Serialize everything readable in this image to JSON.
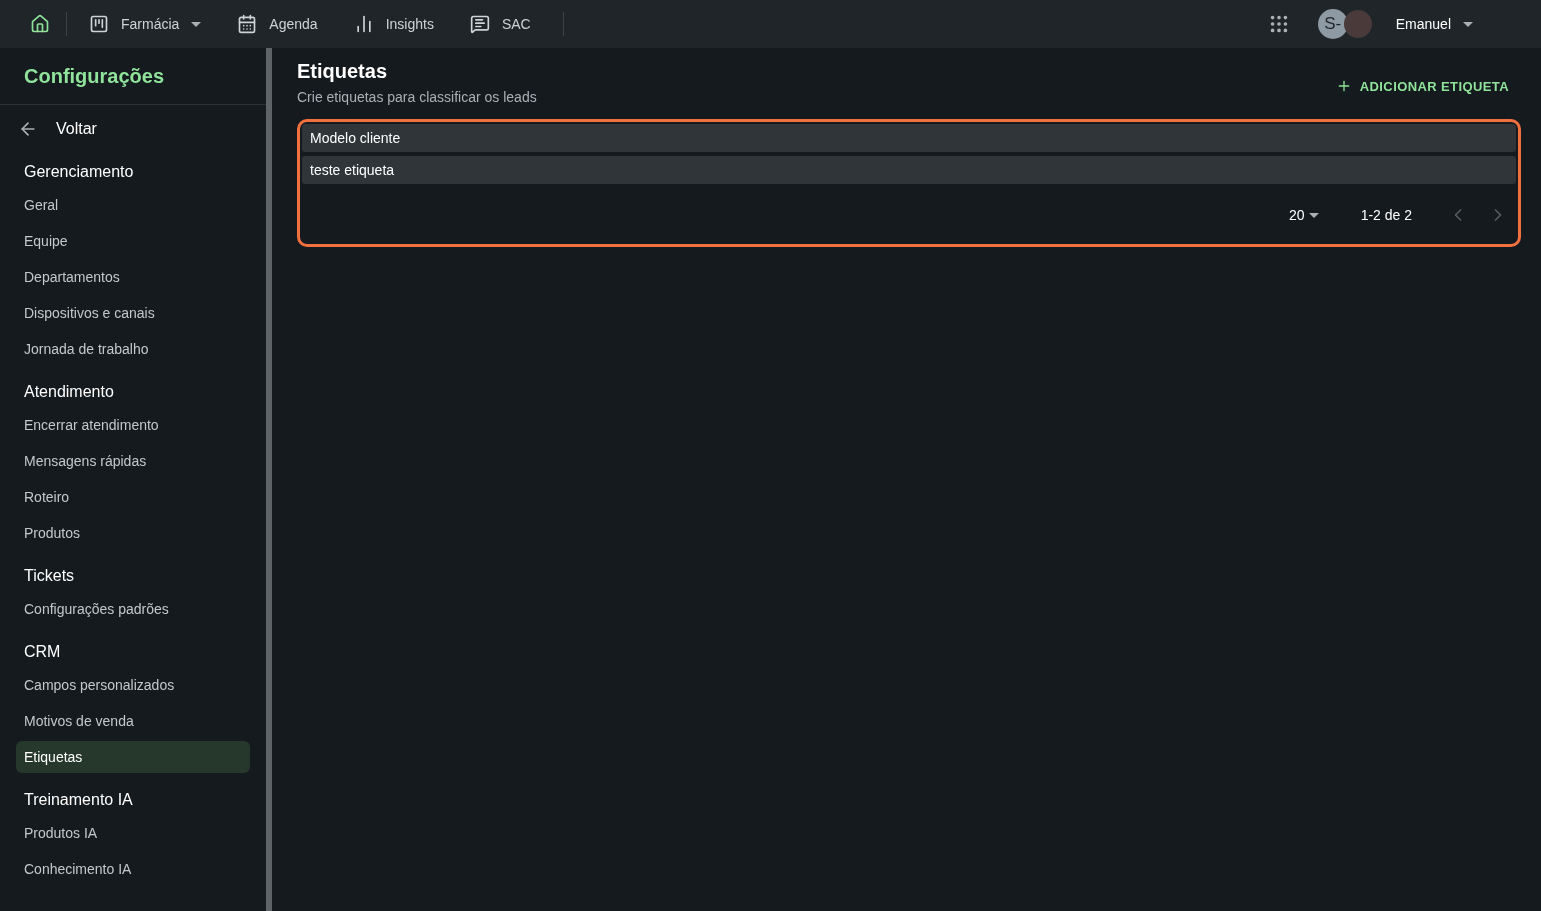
{
  "topbar": {
    "nav": [
      {
        "kind": "home"
      },
      {
        "kind": "workspace",
        "label": "Farmácia"
      },
      {
        "kind": "link",
        "label": "Agenda"
      },
      {
        "kind": "link",
        "label": "Insights"
      },
      {
        "kind": "link",
        "label": "SAC"
      }
    ],
    "avatar_initials": "S-",
    "user_name": "Emanuel"
  },
  "sidebar": {
    "title": "Configurações",
    "back_label": "Voltar",
    "sections": [
      {
        "heading": "Gerenciamento",
        "items": [
          {
            "label": "Geral",
            "selected": false
          },
          {
            "label": "Equipe",
            "selected": false
          },
          {
            "label": "Departamentos",
            "selected": false
          },
          {
            "label": "Dispositivos e canais",
            "selected": false
          },
          {
            "label": "Jornada de trabalho",
            "selected": false
          }
        ]
      },
      {
        "heading": "Atendimento",
        "items": [
          {
            "label": "Encerrar atendimento",
            "selected": false
          },
          {
            "label": "Mensagens rápidas",
            "selected": false
          },
          {
            "label": "Roteiro",
            "selected": false
          },
          {
            "label": "Produtos",
            "selected": false
          }
        ]
      },
      {
        "heading": "Tickets",
        "items": [
          {
            "label": "Configurações padrões",
            "selected": false
          }
        ]
      },
      {
        "heading": "CRM",
        "items": [
          {
            "label": "Campos personalizados",
            "selected": false
          },
          {
            "label": "Motivos de venda",
            "selected": false
          },
          {
            "label": "Etiquetas",
            "selected": true
          }
        ]
      },
      {
        "heading": "Treinamento IA",
        "items": [
          {
            "label": "Produtos IA",
            "selected": false
          },
          {
            "label": "Conhecimento IA",
            "selected": false
          }
        ]
      }
    ]
  },
  "page": {
    "title": "Etiquetas",
    "subtitle": "Crie etiquetas para classificar os leads",
    "add_button": "ADICIONAR ETIQUETA"
  },
  "table": {
    "rows": [
      "Modelo cliente",
      "teste etiqueta"
    ],
    "rows_per_page": "20",
    "range": "1-2 de 2"
  }
}
